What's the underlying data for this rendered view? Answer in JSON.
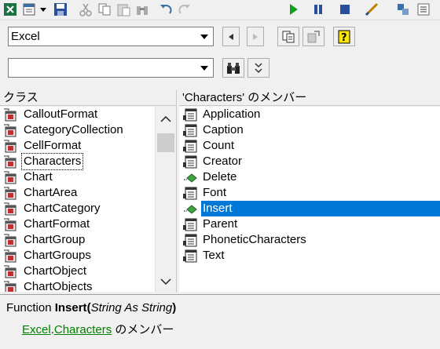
{
  "toolbar": {
    "icons": [
      "excel-icon",
      "view-object-icon",
      "dropdown-arrow-icon",
      "save-icon",
      "cut-icon",
      "copy-icon",
      "paste-icon",
      "find-icon",
      "undo-icon",
      "redo-icon",
      "run-icon",
      "break-icon",
      "reset-icon",
      "design-mode-icon",
      "project-explorer-icon",
      "properties-icon"
    ]
  },
  "library_combo": {
    "value": "Excel"
  },
  "search_combo": {
    "value": ""
  },
  "classes_pane": {
    "header": "クラス",
    "items": [
      {
        "label": "CalloutFormat"
      },
      {
        "label": "CategoryCollection"
      },
      {
        "label": "CellFormat"
      },
      {
        "label": "Characters"
      },
      {
        "label": "Chart"
      },
      {
        "label": "ChartArea"
      },
      {
        "label": "ChartCategory"
      },
      {
        "label": "ChartFormat"
      },
      {
        "label": "ChartGroup"
      },
      {
        "label": "ChartGroups"
      },
      {
        "label": "ChartObject"
      },
      {
        "label": "ChartObjects"
      }
    ],
    "focused_item": "Characters"
  },
  "members_pane": {
    "header": "'Characters' のメンバー",
    "items": [
      {
        "label": "Application",
        "kind": "property"
      },
      {
        "label": "Caption",
        "kind": "property"
      },
      {
        "label": "Count",
        "kind": "property"
      },
      {
        "label": "Creator",
        "kind": "property"
      },
      {
        "label": "Delete",
        "kind": "method"
      },
      {
        "label": "Font",
        "kind": "property"
      },
      {
        "label": "Insert",
        "kind": "method"
      },
      {
        "label": "Parent",
        "kind": "property"
      },
      {
        "label": "PhoneticCharacters",
        "kind": "property"
      },
      {
        "label": "Text",
        "kind": "property"
      }
    ],
    "selected_item": "Insert"
  },
  "detail": {
    "prefix": "Function ",
    "name": "Insert",
    "open_paren": "(",
    "params": "String As String",
    "close_paren": ")",
    "library_link": "Excel",
    "dot": ".",
    "class_link": "Characters",
    "suffix": " のメンバー"
  }
}
